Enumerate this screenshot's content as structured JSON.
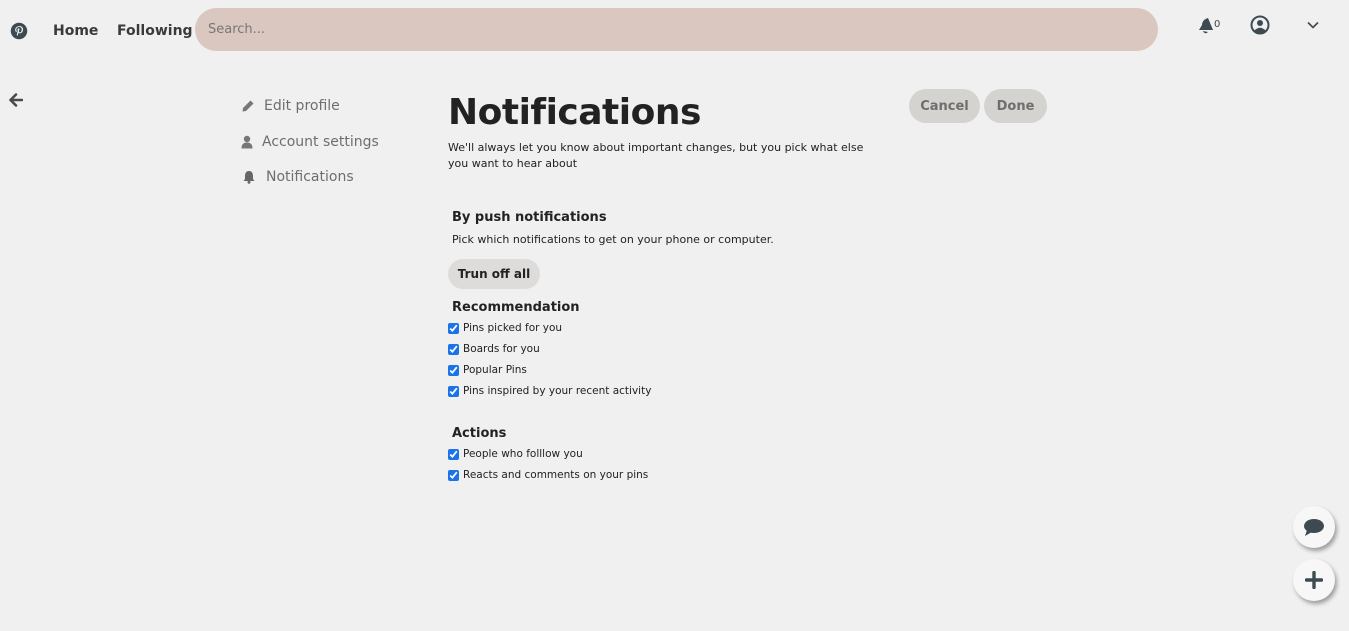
{
  "header": {
    "logo_icon": "pinterest-logo-icon",
    "nav": {
      "home": "Home",
      "following": "Following"
    },
    "search_placeholder": "Search...",
    "notifications_count": "0",
    "icons": [
      "bell-icon",
      "account-icon",
      "chevron-down-icon"
    ]
  },
  "sidebar": {
    "items": [
      {
        "label": "Edit profile",
        "icon": "pencil-icon"
      },
      {
        "label": "Account settings",
        "icon": "user-icon"
      },
      {
        "label": "Notifications",
        "icon": "bell-icon"
      }
    ]
  },
  "main": {
    "title": "Notifications",
    "subtitle": "We'll always let you know about important changes, but you pick what else you want to hear about",
    "cancel_label": "Cancel",
    "done_label": "Done",
    "push": {
      "title": "By push notifications",
      "description": "Pick which notifications to get on your phone or computer.",
      "turn_off_label": "Trun off all"
    },
    "recommendation": {
      "title": "Recommendation",
      "options": [
        {
          "label": "Pins picked for you",
          "checked": true
        },
        {
          "label": "Boards for you",
          "checked": true
        },
        {
          "label": "Popular Pins",
          "checked": true
        },
        {
          "label": "Pins inspired by your recent activity",
          "checked": true
        }
      ]
    },
    "actions": {
      "title": "Actions",
      "options": [
        {
          "label": "People who folllow you",
          "checked": true
        },
        {
          "label": "Reacts and comments on your pins",
          "checked": true
        }
      ]
    }
  },
  "fabs": [
    "chat-icon",
    "plus-icon"
  ],
  "colors": {
    "search_bg": "#dac7bf",
    "page_bg": "#f0f0f0",
    "pill_bg": "#d5d3d0",
    "checkbox": "#1a73e8"
  }
}
